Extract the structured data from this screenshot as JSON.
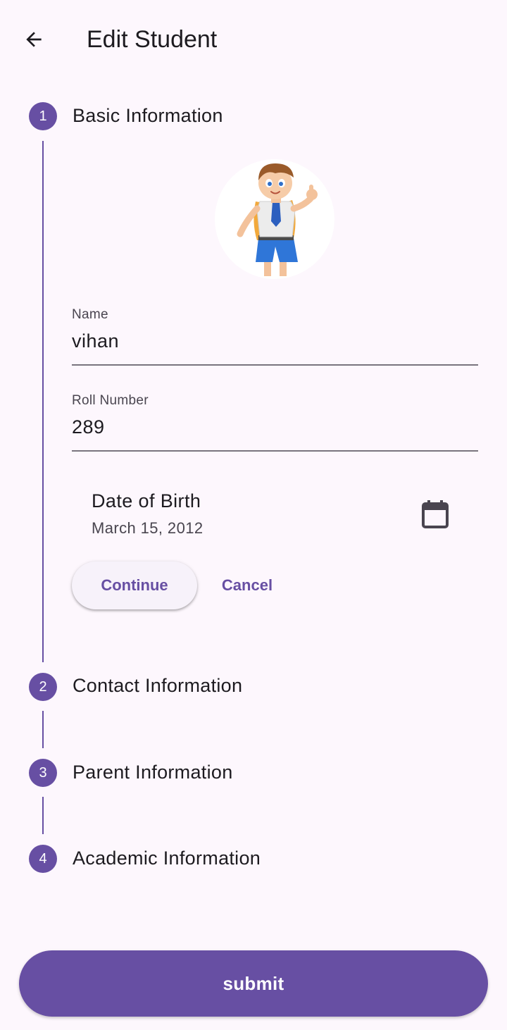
{
  "app_bar": {
    "title": "Edit Student",
    "back_icon": "arrow-left-icon"
  },
  "stepper": {
    "steps": [
      {
        "number": "1",
        "title": "Basic Information",
        "active": true
      },
      {
        "number": "2",
        "title": "Contact Information",
        "active": false
      },
      {
        "number": "3",
        "title": "Parent Information",
        "active": false
      },
      {
        "number": "4",
        "title": "Academic Information",
        "active": false
      }
    ]
  },
  "basic_info": {
    "avatar_icon": "student-cartoon-avatar",
    "name": {
      "label": "Name",
      "value": "vihan"
    },
    "roll_number": {
      "label": "Roll Number",
      "value": "289"
    },
    "date_of_birth": {
      "label": "Date of Birth",
      "value": "March 15, 2012",
      "icon": "calendar-icon"
    },
    "continue_label": "Continue",
    "cancel_label": "Cancel"
  },
  "submit_label": "submit",
  "colors": {
    "primary": "#674fa3",
    "background": "#fdf7fd",
    "surface": "#f7f2fa",
    "text": "#1d1b20",
    "text_secondary": "#49454f",
    "outline": "#79747e"
  }
}
